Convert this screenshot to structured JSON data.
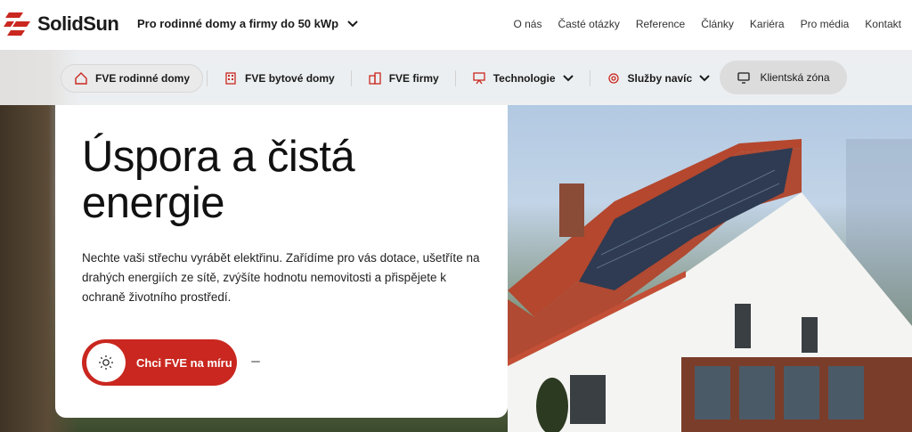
{
  "brand": {
    "name": "SolidSun",
    "accent": "#c9271f"
  },
  "segment": {
    "label": "Pro rodinné domy a firmy do 50 kWp",
    "icon": "chevron-down-icon"
  },
  "top_links": [
    "O nás",
    "Časté otázky",
    "Reference",
    "Články",
    "Kariéra",
    "Pro média",
    "Kontakt"
  ],
  "nav": {
    "items": [
      {
        "label": "FVE rodinné domy",
        "icon": "house-icon",
        "active": true
      },
      {
        "label": "FVE bytové domy",
        "icon": "apartment-building-icon"
      },
      {
        "label": "FVE firmy",
        "icon": "office-building-icon"
      },
      {
        "label": "Technologie",
        "icon": "presentation-icon",
        "dropdown": true
      },
      {
        "label": "Služby navíc",
        "icon": "gear-icon",
        "dropdown": true
      }
    ],
    "client_zone": {
      "label": "Klientská zóna",
      "icon": "monitor-icon"
    }
  },
  "hero": {
    "title": "Úspora a čistá energie",
    "lead": "Nechte vaši střechu vyrábět elektřinu. Zařídíme pro vás dotace, ušetříte na drahých energiích ze sítě, zvýšíte hodnotu nemovitosti a přispějete k ochraně životního prostředí.",
    "cta": {
      "label": "Chci FVE na míru",
      "icon": "sun-icon"
    }
  }
}
